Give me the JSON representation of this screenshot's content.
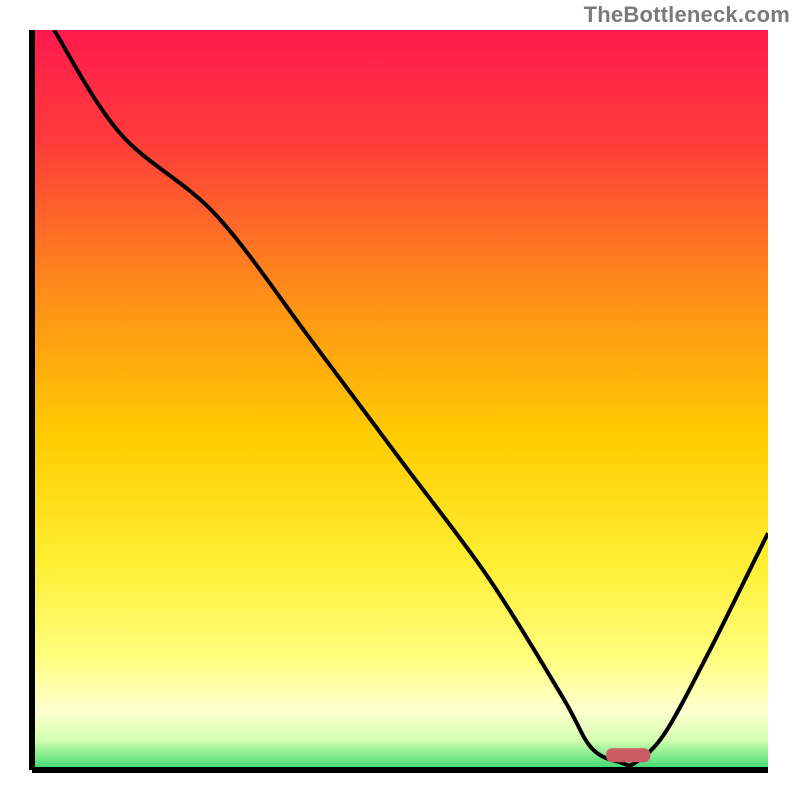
{
  "attribution": "TheBottleneck.com",
  "chart_data": {
    "type": "line",
    "title": "",
    "xlabel": "",
    "ylabel": "",
    "xlim": [
      0,
      100
    ],
    "ylim": [
      0,
      100
    ],
    "series": [
      {
        "name": "curve",
        "x": [
          3,
          12,
          25,
          38,
          50,
          62,
          72,
          76,
          80,
          82,
          86,
          92,
          98,
          100
        ],
        "values": [
          100,
          86,
          75,
          58,
          42,
          26,
          10,
          3,
          1,
          1,
          5,
          16,
          28,
          32
        ]
      }
    ],
    "marker": {
      "x_start": 78,
      "x_end": 84,
      "y": 2
    },
    "gradient_stops": [
      {
        "offset": 0,
        "color": "#ff1a4d"
      },
      {
        "offset": 15,
        "color": "#ff3b3b"
      },
      {
        "offset": 35,
        "color": "#ff8c1a"
      },
      {
        "offset": 55,
        "color": "#ffcc00"
      },
      {
        "offset": 72,
        "color": "#ffee33"
      },
      {
        "offset": 85,
        "color": "#ffff80"
      },
      {
        "offset": 92,
        "color": "#ffffd0"
      },
      {
        "offset": 96,
        "color": "#d4ffb0"
      },
      {
        "offset": 100,
        "color": "#33d96b"
      }
    ],
    "marker_color": "#cc5a63",
    "axis_color": "#000000"
  }
}
